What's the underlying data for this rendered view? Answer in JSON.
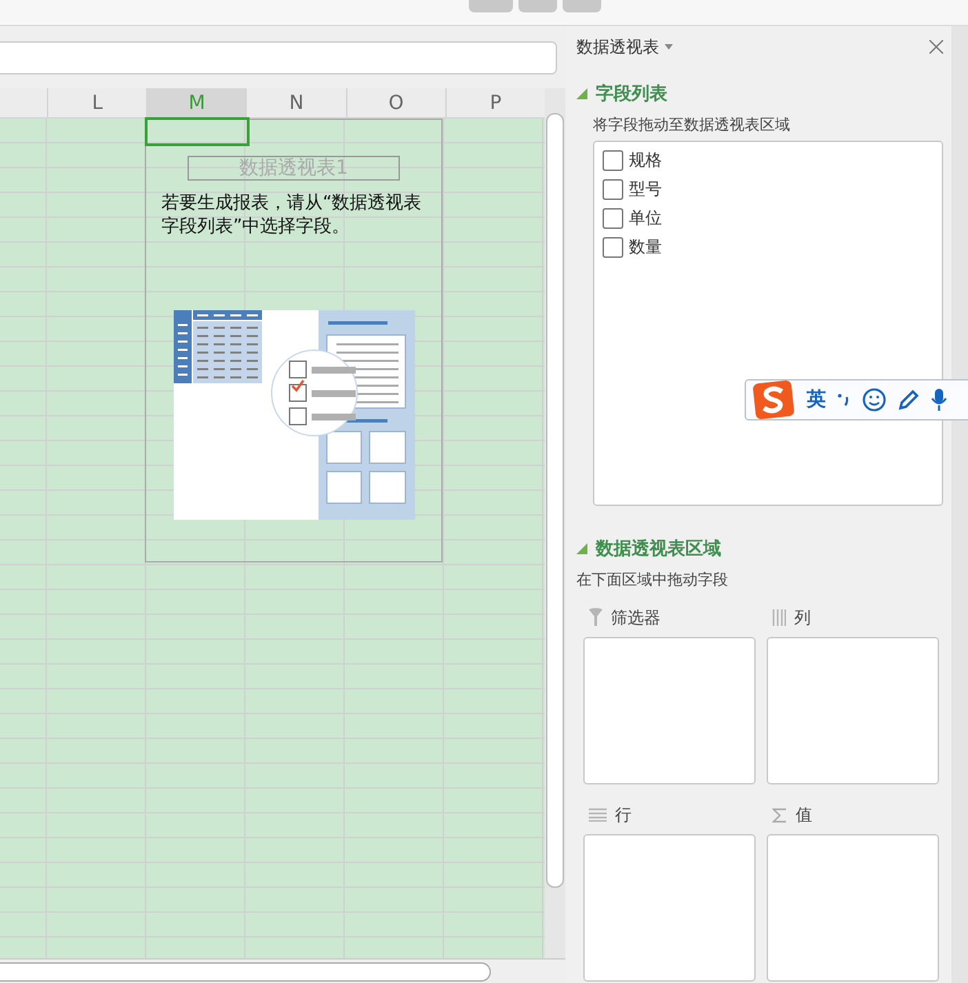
{
  "sheet": {
    "columns": [
      {
        "label": "L",
        "selected": false
      },
      {
        "label": "M",
        "selected": true
      },
      {
        "label": "N",
        "selected": false
      },
      {
        "label": "O",
        "selected": false
      },
      {
        "label": "P",
        "selected": false
      }
    ]
  },
  "pivot_placeholder": {
    "title": "数据透视表1",
    "message": "若要生成报表，请从“数据透视表字段列表”中选择字段。"
  },
  "panel": {
    "title": "数据透视表",
    "field_section": {
      "heading": "字段列表",
      "expanded": true,
      "hint": "将字段拖动至数据透视表区域",
      "fields": [
        {
          "label": "规格",
          "checked": false
        },
        {
          "label": "型号",
          "checked": false
        },
        {
          "label": "单位",
          "checked": false
        },
        {
          "label": "数量",
          "checked": false
        }
      ]
    },
    "area_section": {
      "heading": "数据透视表区域",
      "expanded": true,
      "hint": "在下面区域中拖动字段",
      "zones": [
        {
          "kind": "filter",
          "label": "筛选器"
        },
        {
          "kind": "columns",
          "label": "列"
        },
        {
          "kind": "rows",
          "label": "行"
        },
        {
          "kind": "values",
          "label": "值"
        }
      ]
    }
  },
  "ime_toolbar": {
    "mode": "英"
  }
}
